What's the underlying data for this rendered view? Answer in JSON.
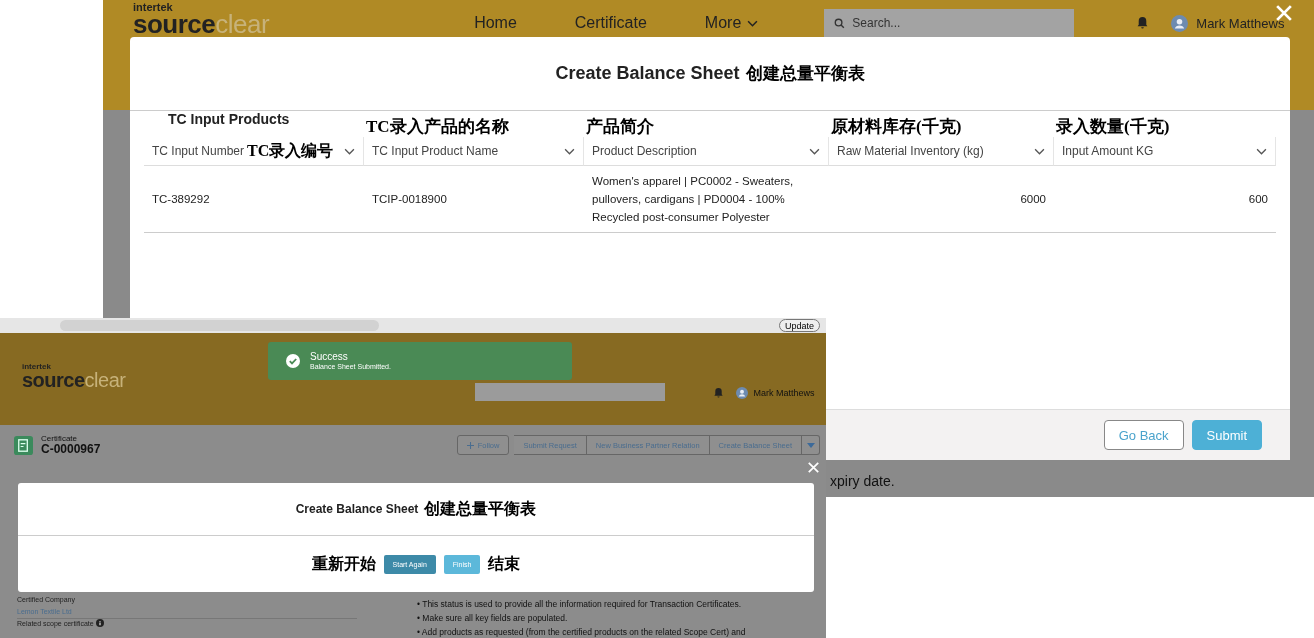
{
  "back_screen": {
    "header": {
      "logo_top": "intertek",
      "logo_main": "source",
      "logo_accent": "clear",
      "nav": [
        {
          "label": "Home",
          "dropdown": false
        },
        {
          "label": "Certificate",
          "dropdown": false
        },
        {
          "label": "More",
          "dropdown": true
        }
      ],
      "search": {
        "placeholder": "Search..."
      },
      "user": "Mark Matthews"
    },
    "modal": {
      "title": "Create Balance Sheet",
      "title_note": "创建总量平衡表",
      "card_title": "TC Input Products",
      "columns": [
        {
          "label": "TC Input Number",
          "inline_note": "TC录入编号",
          "kind": "text"
        },
        {
          "label": "TC Input Product Name",
          "note": "TC录入产品的名称",
          "kind": "text"
        },
        {
          "label": "Product Description",
          "note": "产品简介",
          "kind": "text"
        },
        {
          "label": "Raw Material Inventory (kg)",
          "note": "原材料库存(千克)",
          "kind": "number"
        },
        {
          "label": "Input Amount KG",
          "note": "录入数量(千克)",
          "kind": "number"
        }
      ],
      "rows": [
        [
          "TC-389292",
          "TCIP-0018900",
          "Women's apparel | PC0002 - Sweaters, pullovers, cardigans | PD0004 - 100% Recycled post-consumer Polyester",
          "6000",
          "600"
        ]
      ],
      "buttons": [
        {
          "label": "Go Back",
          "kind": "neutral"
        },
        {
          "label": "Submit",
          "kind": "brand"
        }
      ]
    },
    "background_text": "xpiry date."
  },
  "front_screen": {
    "browser": {
      "update_button": "Update"
    },
    "header": {
      "logo_top": "intertek",
      "logo_main": "source",
      "logo_accent": "clear",
      "user": "Mark Matthews"
    },
    "toast": {
      "title": "Success",
      "message": "Balance Sheet Submitted."
    },
    "record": {
      "type": "Certificate",
      "name": "C-0000967"
    },
    "actions": [
      {
        "label": "Follow",
        "kind": "follow"
      },
      {
        "label": "Submit Request",
        "kind": "action"
      },
      {
        "label": "New Business Partner Relation",
        "kind": "action"
      },
      {
        "label": "Create Balance Sheet",
        "kind": "action"
      },
      {
        "kind": "menu"
      }
    ],
    "modal": {
      "title": "Create Balance Sheet",
      "title_note": "创建总量平衡表",
      "before_note": "重新开始",
      "buttons": [
        {
          "label": "Start Again",
          "kind": "dark"
        },
        {
          "label": "Finish",
          "kind": "light"
        }
      ],
      "after_note": "结束"
    },
    "fields": [
      {
        "label": "Certified Company",
        "value": "Lemon Textile Ltd"
      },
      {
        "label": "Related scope certificate",
        "info": true
      }
    ],
    "bullets": [
      "• This status is used to provide all the information required for Transaction Certificates.",
      "• Make sure all key fields are populated.",
      "• Add products as requested (from the certified products on the related Scope Cert) and"
    ]
  }
}
